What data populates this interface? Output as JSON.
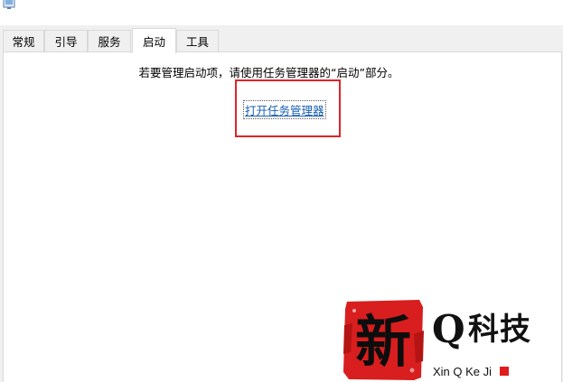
{
  "window": {
    "icon": "system-config-icon"
  },
  "tabs": [
    {
      "label": "常规",
      "active": false
    },
    {
      "label": "引导",
      "active": false
    },
    {
      "label": "服务",
      "active": false
    },
    {
      "label": "启动",
      "active": true
    },
    {
      "label": "工具",
      "active": false
    }
  ],
  "startup_panel": {
    "instruction": "若要管理启动项，请使用任务管理器的“启动”部分。",
    "open_task_manager_link": "打开任务管理器"
  },
  "watermark": {
    "stamp_char": "新",
    "brand_q": "Q",
    "brand_cn": "科技",
    "brand_latin": "Xin Q Ke Ji",
    "accent_color": "#e11c1c"
  },
  "colors": {
    "highlight_border": "#d9252b",
    "link": "#1a5fb4"
  }
}
